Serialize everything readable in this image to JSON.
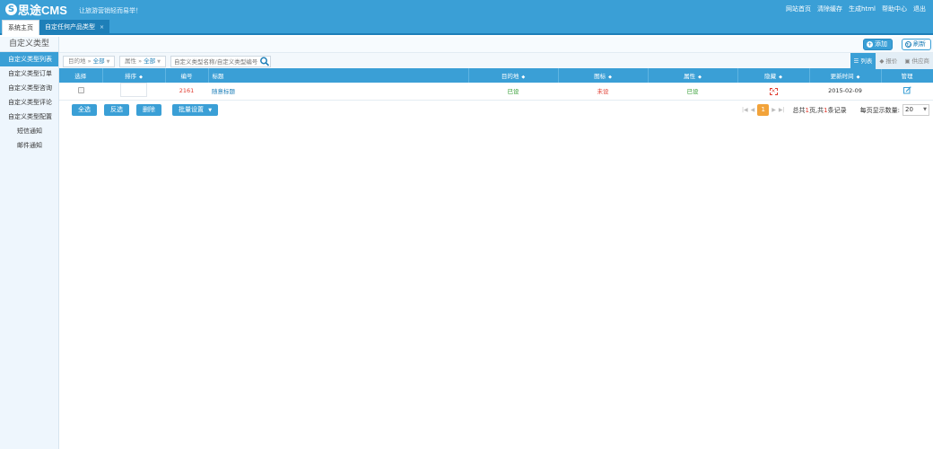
{
  "header": {
    "logo_mark": "S",
    "logo_text": "思途CMS",
    "slogan": "让旅游营销轻而易举！",
    "links": [
      "网站首页",
      "清除缓存",
      "生成html",
      "帮助中心",
      "退出"
    ]
  },
  "tabs": {
    "home": "系统主页",
    "active": "自定任何产品类型",
    "close": "×"
  },
  "sidebar": {
    "title": "自定义类型",
    "items": [
      {
        "label": "自定义类型列表"
      },
      {
        "label": "自定义类型订单"
      },
      {
        "label": "自定义类型咨询"
      },
      {
        "label": "自定义类型评论"
      },
      {
        "label": "自定义类型配置"
      },
      {
        "label": "短信通知"
      },
      {
        "label": "邮件通知"
      }
    ]
  },
  "toolbar": {
    "add_label": "添加",
    "refresh_label": "刷新"
  },
  "filters": {
    "destination_label": "目的地",
    "destination_value": "全部",
    "attribute_label": "属性",
    "attribute_value": "全部",
    "search_placeholder": "自定义类型名称/自定义类型编号",
    "view_list": "列表",
    "view_price": "报价",
    "view_supplier": "供应商"
  },
  "table": {
    "headers": {
      "select": "选择",
      "order": "排序",
      "id": "编号",
      "title": "标题",
      "destination": "目的地",
      "icon": "图标",
      "attribute": "属性",
      "hidden": "隐藏",
      "updated": "更新时间",
      "manage": "管理"
    },
    "rows": [
      {
        "id": "2161",
        "title": "随意标题",
        "destination": "已设",
        "icon": "未设",
        "attribute": "已设",
        "updated": "2015-02-09"
      }
    ]
  },
  "bottom": {
    "select_all": "全选",
    "invert": "反选",
    "delete": "删除",
    "batch": "批量设置",
    "page_current": "1",
    "summary_a": "总共",
    "summary_pages": "1",
    "summary_b": "页,共",
    "summary_records": "1",
    "summary_c": "条记录",
    "per_page_label": "每页显示数量:",
    "per_page_value": "20"
  },
  "colors": {
    "brand": "#3a9fd6",
    "accent": "#f2a33a",
    "danger": "#e03b2f",
    "success": "#2e9b2e"
  }
}
